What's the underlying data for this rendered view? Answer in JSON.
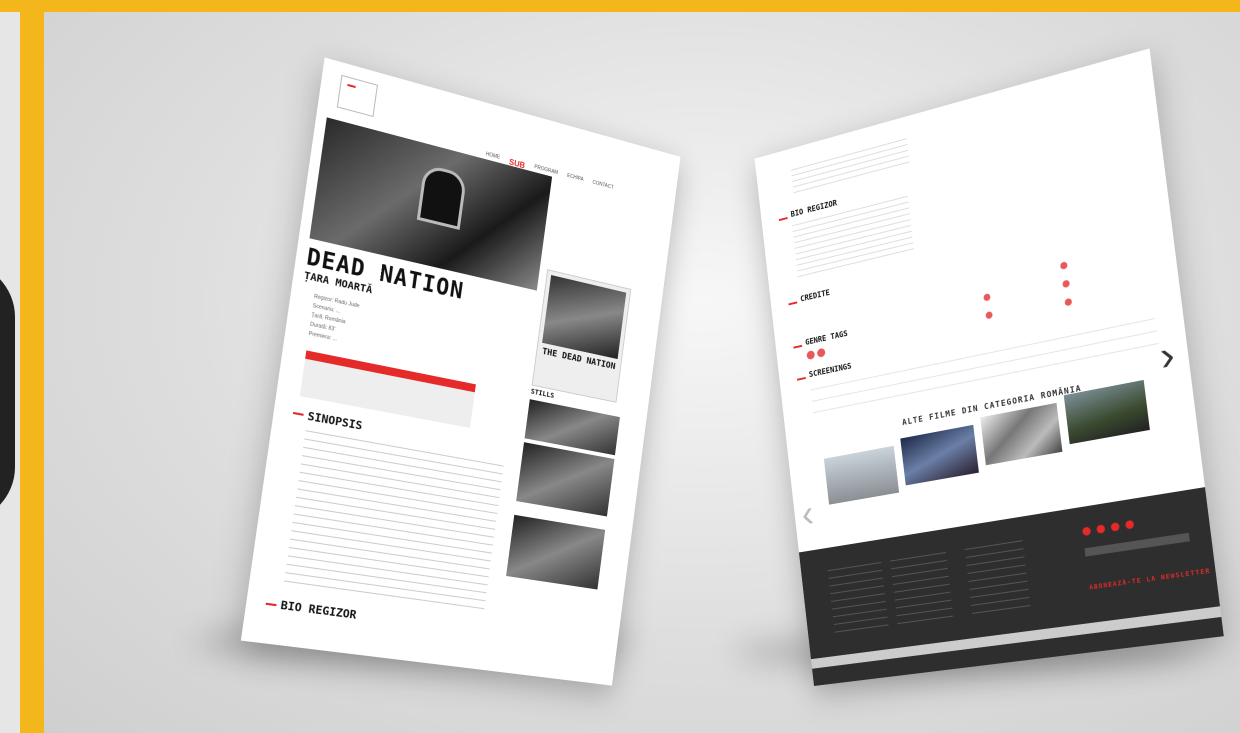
{
  "left_page": {
    "nav": {
      "active": "SUB",
      "items": [
        "HOME",
        "SUB",
        "PROGRAM",
        "ECHIPA",
        "CONTACT"
      ]
    },
    "movie": {
      "title": "DEAD NATION",
      "subtitle": "ȚARA MOARTĂ"
    },
    "meta": [
      "Regizor: Radu Jude",
      "Scenariu: ...",
      "Țară: România",
      "Durată: 83'",
      "Premiera: ..."
    ],
    "poster_title": "THE DEAD NATION",
    "stills_heading": "STILLS",
    "sections": {
      "synopsis": "SINOPSIS",
      "bio": "BIO REGIZOR"
    }
  },
  "right_page": {
    "sections": {
      "bio": "BIO REGIZOR",
      "credits": "CREDITE",
      "genre": "GENRE TAGS",
      "schedule": "SCREENINGS"
    },
    "other_heading": "ALTE FILME DIN CATEGORIA ROMÂNIA",
    "newsletter": "ABONEAZĂ-TE LA NEWSLETTER"
  },
  "colors": {
    "accent": "#e52a2a",
    "frame": "#f3b61b",
    "footer": "#2e2e2e"
  },
  "icons": {
    "next": "chevron-right-icon",
    "prev": "chevron-left-icon"
  }
}
